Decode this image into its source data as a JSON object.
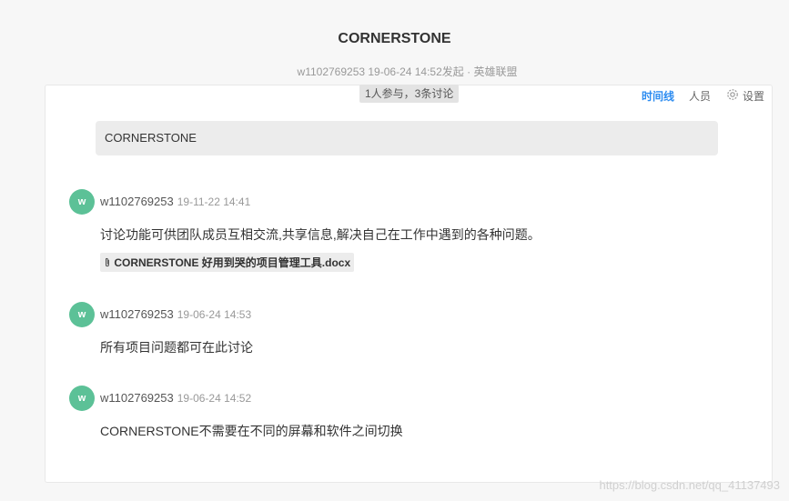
{
  "page": {
    "title": "CORNERSTONE",
    "meta": "w1102769253 19-06-24 14:52发起 · 英雄联盟"
  },
  "card": {
    "participants": "1人参与，3条讨论",
    "tabs": [
      {
        "label": "时间线",
        "active": true
      },
      {
        "label": "人员",
        "active": false
      },
      {
        "label": "设置",
        "active": false,
        "icon": "gear-icon"
      }
    ],
    "topic": "CORNERSTONE"
  },
  "messages": [
    {
      "avatar": "w",
      "author": "w1102769253",
      "time": "19-11-22 14:41",
      "body": "讨论功能可供团队成员互相交流,共享信息,解决自己在工作中遇到的各种问题。",
      "attachment": "CORNERSTONE 好用到哭的项目管理工具.docx",
      "attachment_icon": "paperclip-icon"
    },
    {
      "avatar": "w",
      "author": "w1102769253",
      "time": "19-06-24 14:53",
      "body": "所有项目问题都可在此讨论"
    },
    {
      "avatar": "w",
      "author": "w1102769253",
      "time": "19-06-24 14:52",
      "body": "CORNERSTONE不需要在不同的屏幕和软件之间切换"
    }
  ],
  "watermark": "https://blog.csdn.net/qq_41137493",
  "colors": {
    "accent": "#2d8cf0",
    "avatar": "#5cc197"
  }
}
